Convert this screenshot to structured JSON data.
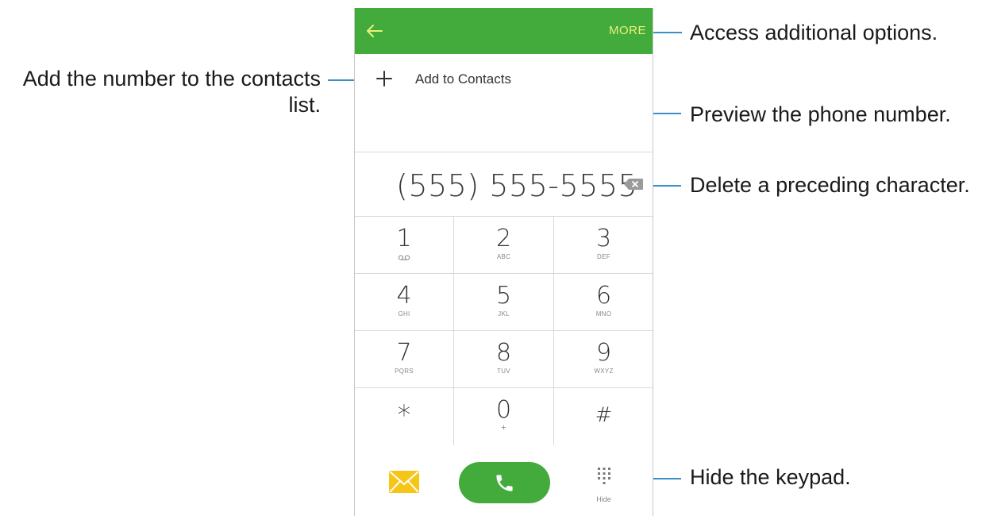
{
  "app": {
    "more_label": "MORE",
    "add_to_contacts_label": "Add to Contacts",
    "phone_number": "(555) 555-5555",
    "hide_label": "Hide",
    "colors": {
      "accent_green": "#43ab3c",
      "more_text": "#e8f27a",
      "callout_line": "#3b8fc7",
      "message_yellow": "#f5c518"
    },
    "keypad": [
      [
        {
          "digit": "1",
          "letters": ""
        },
        {
          "digit": "2",
          "letters": "ABC"
        },
        {
          "digit": "3",
          "letters": "DEF"
        }
      ],
      [
        {
          "digit": "4",
          "letters": "GHI"
        },
        {
          "digit": "5",
          "letters": "JKL"
        },
        {
          "digit": "6",
          "letters": "MNO"
        }
      ],
      [
        {
          "digit": "7",
          "letters": "PQRS"
        },
        {
          "digit": "8",
          "letters": "TUV"
        },
        {
          "digit": "9",
          "letters": "WXYZ"
        }
      ],
      [
        {
          "digit": "*",
          "letters": ""
        },
        {
          "digit": "0",
          "letters": "+"
        },
        {
          "digit": "#",
          "letters": ""
        }
      ]
    ],
    "icons": [
      "back-arrow-icon",
      "plus-icon",
      "backspace-icon",
      "voicemail-icon",
      "message-icon",
      "phone-call-icon",
      "keypad-dots-icon"
    ]
  },
  "callouts": {
    "more": "Access additional options.",
    "add_contacts_line1": "Add the number to the contacts",
    "add_contacts_line2": "list.",
    "preview": "Preview the phone number.",
    "delete": "Delete a preceding character.",
    "hide": "Hide the keypad."
  }
}
